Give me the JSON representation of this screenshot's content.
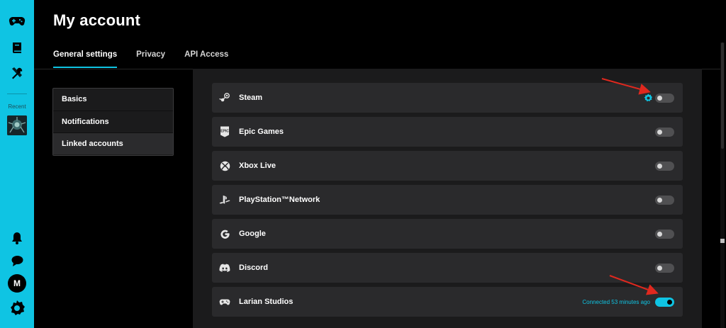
{
  "page": {
    "title": "My account"
  },
  "tabs": [
    {
      "label": "General settings",
      "active": true
    },
    {
      "label": "Privacy",
      "active": false
    },
    {
      "label": "API Access",
      "active": false
    }
  ],
  "sidebar": {
    "recent_label": "Recent",
    "avatar_letter": "M",
    "icons": [
      "controller-icon",
      "library-book-icon",
      "tools-icon",
      "game-thumbnail",
      "bell-icon",
      "chat-bubble-icon",
      "avatar",
      "settings-cog-icon"
    ]
  },
  "submenu": [
    {
      "label": "Basics",
      "active": false
    },
    {
      "label": "Notifications",
      "active": false
    },
    {
      "label": "Linked accounts",
      "active": true
    }
  ],
  "linked_accounts": [
    {
      "name": "Steam",
      "icon": "steam-icon",
      "enabled": false,
      "has_settings": true,
      "status": ""
    },
    {
      "name": "Epic Games",
      "icon": "epic-games-icon",
      "enabled": false,
      "has_settings": false,
      "status": ""
    },
    {
      "name": "Xbox Live",
      "icon": "xbox-icon",
      "enabled": false,
      "has_settings": false,
      "status": ""
    },
    {
      "name": "PlayStation™Network",
      "icon": "playstation-icon",
      "enabled": false,
      "has_settings": false,
      "status": ""
    },
    {
      "name": "Google",
      "icon": "google-icon",
      "enabled": false,
      "has_settings": false,
      "status": ""
    },
    {
      "name": "Discord",
      "icon": "discord-icon",
      "enabled": false,
      "has_settings": false,
      "status": ""
    },
    {
      "name": "Larian Studios",
      "icon": "controller-icon",
      "enabled": true,
      "has_settings": false,
      "status": "Connected 53 minutes ago"
    }
  ],
  "colors": {
    "accent": "#0fc4e3",
    "background": "#000000",
    "panel": "#1b1b1c",
    "row": "#2a2a2c",
    "annotation_arrow": "#e0281e"
  }
}
